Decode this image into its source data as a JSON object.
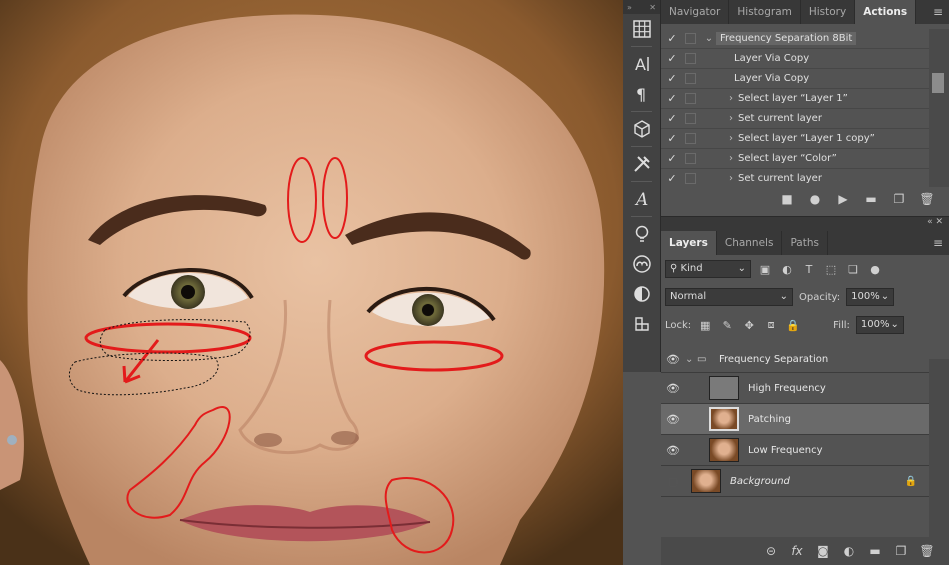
{
  "panels": {
    "top_tabs": [
      "Navigator",
      "Histogram",
      "History",
      "Actions"
    ],
    "active_top_tab": "Actions",
    "actions": [
      {
        "label": "Frequency Separation 8Bit",
        "expandable": true,
        "is_set": true
      },
      {
        "label": "Layer Via Copy",
        "expandable": false
      },
      {
        "label": "Layer Via Copy",
        "expandable": false
      },
      {
        "label": "Select layer “Layer 1”",
        "expandable": true
      },
      {
        "label": "Set current layer",
        "expandable": true
      },
      {
        "label": "Select layer “Layer 1 copy”",
        "expandable": true
      },
      {
        "label": "Select layer “Color”",
        "expandable": true
      },
      {
        "label": "Set current layer",
        "expandable": true
      }
    ],
    "bottom_tabs": [
      "Layers",
      "Channels",
      "Paths"
    ],
    "active_bottom_tab": "Layers",
    "filter_kind": "Kind",
    "blend_mode": "Normal",
    "opacity_label": "Opacity:",
    "opacity_value": "100%",
    "lock_label": "Lock:",
    "fill_label": "Fill:",
    "fill_value": "100%",
    "layers": [
      {
        "name": "Frequency Separation",
        "type": "group",
        "visible": true
      },
      {
        "name": "High Frequency",
        "type": "gray",
        "visible": true,
        "indent": true
      },
      {
        "name": "Patching",
        "type": "photo",
        "visible": true,
        "indent": true,
        "selected": true
      },
      {
        "name": "Low Frequency",
        "type": "photo",
        "visible": true,
        "indent": true
      },
      {
        "name": "Background",
        "type": "photo",
        "visible": false,
        "italic": true,
        "locked": true
      }
    ]
  },
  "colors": {
    "annotation_red": "#e31b1b",
    "panel_bg": "#535353",
    "tab_bar": "#383838"
  }
}
